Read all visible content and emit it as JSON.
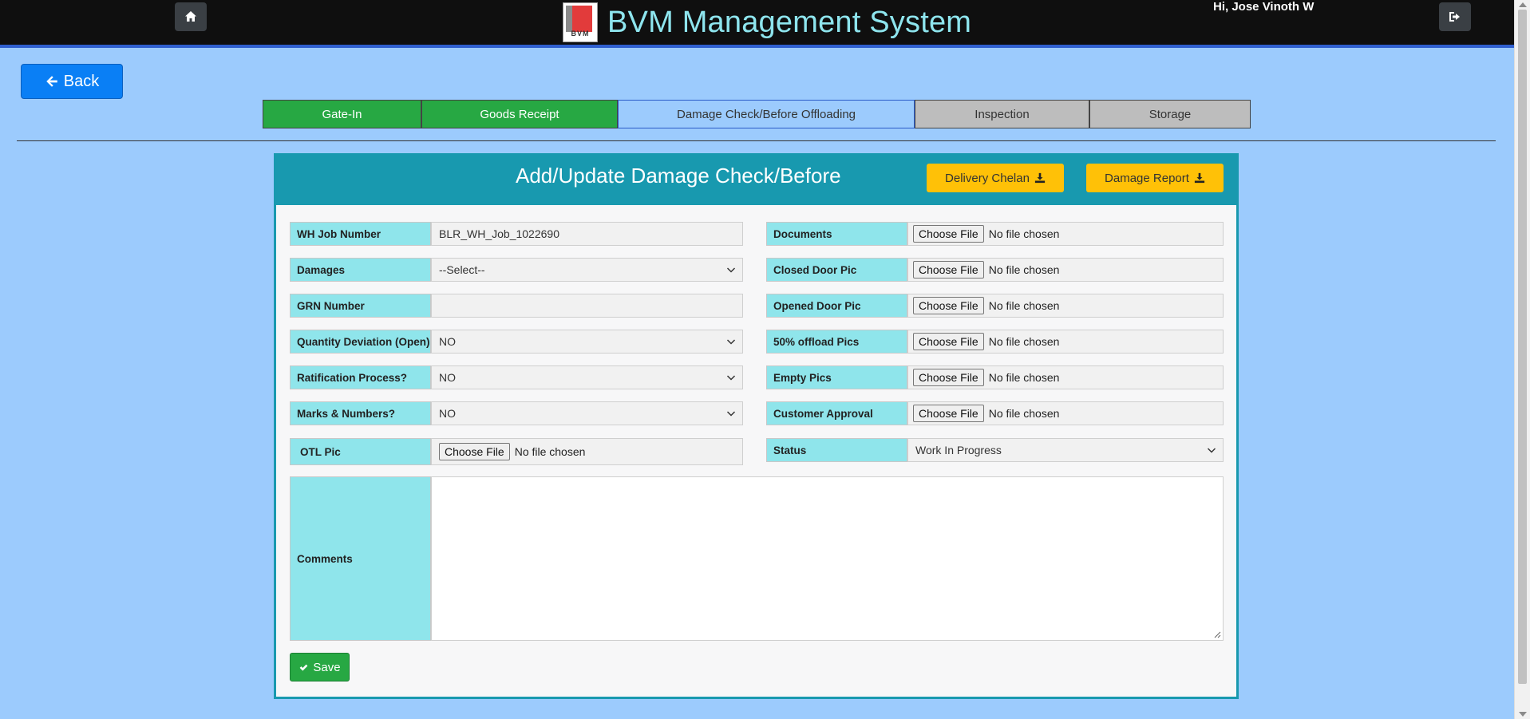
{
  "header": {
    "title": "BVM Management System",
    "logo_text": "BVM",
    "greeting": "Hi, Jose Vinoth W",
    "home_icon": "home-icon",
    "logout_icon": "sign-out-icon"
  },
  "back_button": {
    "label": "Back",
    "icon": "arrow-left-icon"
  },
  "tabs": [
    {
      "label": "Gate-In",
      "state": "done"
    },
    {
      "label": "Goods Receipt",
      "state": "done"
    },
    {
      "label": "Damage Check/Before Offloading",
      "state": "active"
    },
    {
      "label": "Inspection",
      "state": "pending"
    },
    {
      "label": "Storage",
      "state": "pending"
    }
  ],
  "form": {
    "title": "Add/Update Damage Check/Before",
    "delivery_chelan_label": "Delivery Chelan",
    "damage_report_label": "Damage Report",
    "left": [
      {
        "label": "WH Job Number",
        "value": "BLR_WH_Job_1022690",
        "type": "text"
      },
      {
        "label": "Damages",
        "value": "--Select--",
        "type": "select"
      },
      {
        "label": "GRN Number",
        "value": "",
        "type": "text"
      },
      {
        "label": "Quantity Deviation (Open)",
        "value": "NO",
        "type": "select"
      },
      {
        "label": "Ratification Process?",
        "value": "NO",
        "type": "select"
      },
      {
        "label": "Marks & Numbers?",
        "value": "NO",
        "type": "select"
      },
      {
        "label": " OTL Pic",
        "value": "",
        "type": "file"
      }
    ],
    "right": [
      {
        "label": "Documents",
        "type": "file"
      },
      {
        "label": "Closed Door Pic",
        "type": "file"
      },
      {
        "label": "Opened Door Pic",
        "type": "file"
      },
      {
        "label": "50% offload Pics",
        "type": "file"
      },
      {
        "label": "Empty Pics",
        "type": "file"
      },
      {
        "label": "Customer Approval",
        "type": "file"
      },
      {
        "label": "Status",
        "value": "Work In Progress",
        "type": "select"
      }
    ],
    "file_button_label": "Choose File",
    "file_status": "No file chosen",
    "comments_label": "Comments",
    "comments_value": "",
    "save_label": "Save"
  },
  "colors": {
    "page_bg": "#9ccbfd",
    "header_bg": "#0f0f0f",
    "brand_text": "#8ee5ee",
    "card_accent": "#1899af",
    "label_bg": "#8fe5eb",
    "done_tab": "#27a843",
    "pending_tab": "#bdbdbd",
    "warning_btn": "#ffc107",
    "primary_btn": "#0a7ff5"
  }
}
